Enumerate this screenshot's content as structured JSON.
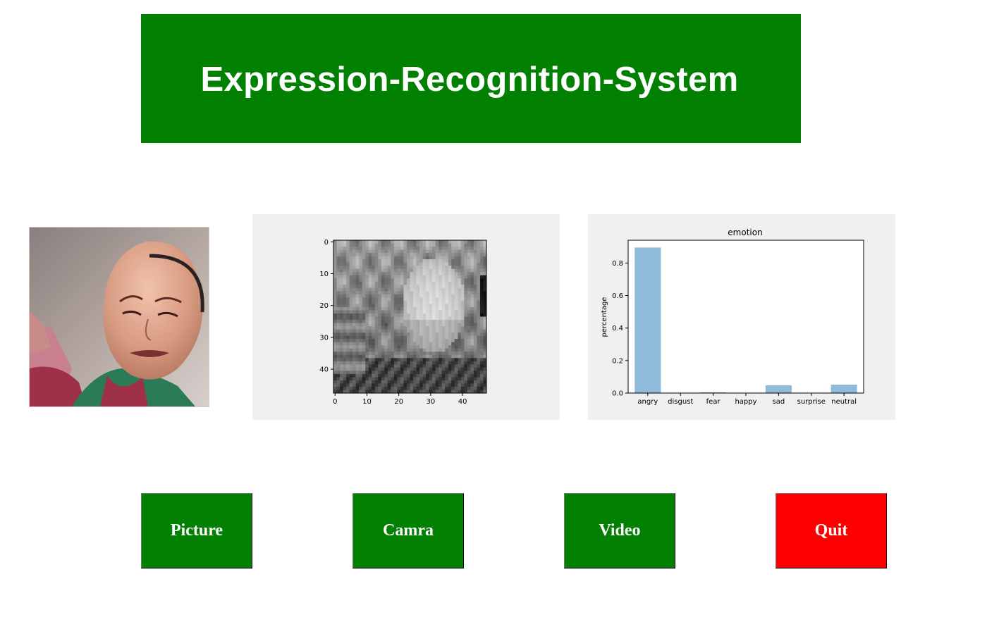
{
  "app": {
    "title": "Expression-Recognition-System"
  },
  "colors": {
    "banner": "#028002",
    "button_green": "#028002",
    "button_quit": "#ff0000",
    "panel_bg": "#f0f0f0",
    "bar": "#8fbad9"
  },
  "photo": {
    "icon": "face-photo"
  },
  "face_plot": {
    "x_ticks": [
      "0",
      "10",
      "20",
      "30",
      "40"
    ],
    "y_ticks": [
      "0",
      "10",
      "20",
      "30",
      "40"
    ],
    "pixel_range": [
      0,
      48
    ]
  },
  "chart_data": {
    "type": "bar",
    "title": "emotion",
    "xlabel": "",
    "ylabel": "percentage",
    "categories": [
      "angry",
      "disgust",
      "fear",
      "happy",
      "sad",
      "surprise",
      "neutral"
    ],
    "values": [
      0.895,
      0.0,
      0.005,
      0.0,
      0.048,
      0.0,
      0.052
    ],
    "y_ticks": [
      "0.0",
      "0.2",
      "0.4",
      "0.6",
      "0.8"
    ],
    "ylim": [
      0,
      0.94
    ],
    "grid": false
  },
  "buttons": {
    "picture": "Picture",
    "camra": "Camra",
    "video": "Video",
    "quit": "Quit"
  }
}
